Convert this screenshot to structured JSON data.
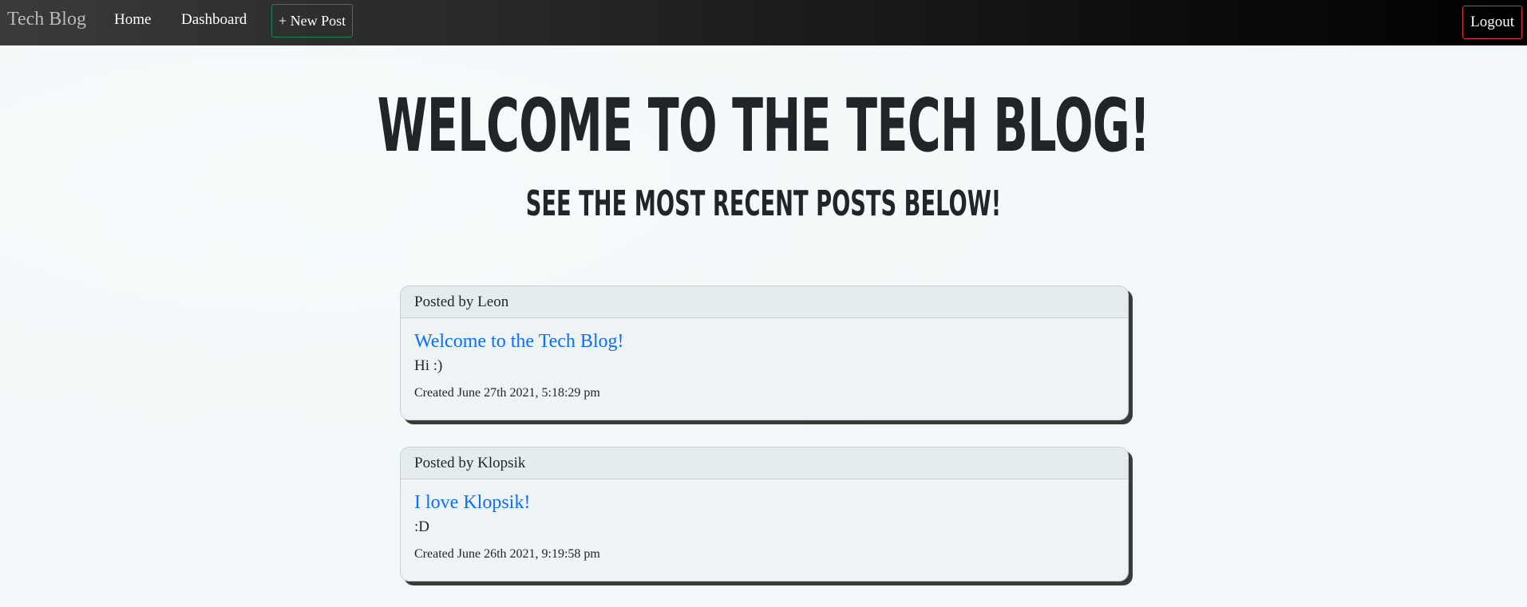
{
  "nav": {
    "brand": "Tech Blog",
    "home": "Home",
    "dashboard": "Dashboard",
    "new_post": "+ New Post",
    "logout": "Logout"
  },
  "hero": {
    "title": "Welcome to the Tech Blog!",
    "subtitle": "See the most recent posts below!"
  },
  "posts": [
    {
      "author_line": "Posted by Leon",
      "title": "Welcome to the Tech Blog!",
      "content": "Hi :)",
      "created": "Created June 27th 2021, 5:18:29 pm"
    },
    {
      "author_line": "Posted by Klopsik",
      "title": "I love Klopsik!",
      "content": ":D",
      "created": "Created June 26th 2021, 9:19:58 pm"
    }
  ],
  "colors": {
    "link": "#0d6efd",
    "new_post_border": "#198754",
    "logout_border": "#dc3545"
  }
}
